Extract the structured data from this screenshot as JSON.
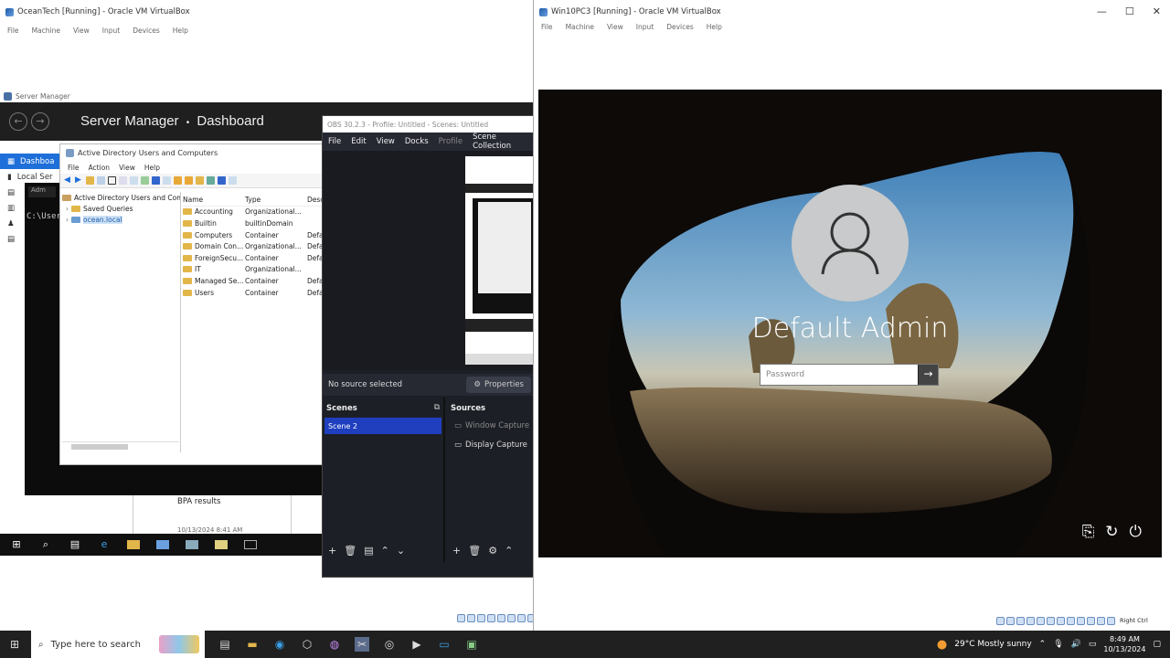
{
  "left_vm": {
    "title": "OceanTech [Running] - Oracle VM VirtualBox",
    "menu": [
      "File",
      "Machine",
      "View",
      "Input",
      "Devices",
      "Help"
    ]
  },
  "server_manager": {
    "window_title": "Server Manager",
    "breadcrumb_app": "Server Manager",
    "breadcrumb_sep": "•",
    "breadcrumb_page": "Dashboard",
    "side_items": [
      "Dashboa",
      "Local Ser"
    ],
    "bpa_label": "BPA results",
    "bpa_date": "10/13/2024 8:41 AM"
  },
  "cmd": {
    "prompt": "C:\\User"
  },
  "aduc": {
    "title": "Active Directory Users and Computers",
    "menu": [
      "File",
      "Action",
      "View",
      "Help"
    ],
    "tree": [
      "Active Directory Users and Com",
      "Saved Queries",
      "ocean.local"
    ],
    "columns": [
      "Name",
      "Type",
      "Desc"
    ],
    "rows": [
      {
        "name": "Accounting",
        "type": "Organizational...",
        "desc": ""
      },
      {
        "name": "Builtin",
        "type": "builtinDomain",
        "desc": ""
      },
      {
        "name": "Computers",
        "type": "Container",
        "desc": "Defa"
      },
      {
        "name": "Domain Con...",
        "type": "Organizational...",
        "desc": "Defa"
      },
      {
        "name": "ForeignSecu...",
        "type": "Container",
        "desc": "Defa"
      },
      {
        "name": "IT",
        "type": "Organizational...",
        "desc": ""
      },
      {
        "name": "Managed Se...",
        "type": "Container",
        "desc": "Defa"
      },
      {
        "name": "Users",
        "type": "Container",
        "desc": "Defa"
      }
    ]
  },
  "obs": {
    "title": "OBS 30.2.3 - Profile: Untitled - Scenes: Untitled",
    "menu": [
      "File",
      "Edit",
      "View",
      "Docks",
      "Profile",
      "Scene Collection"
    ],
    "no_source": "No source selected",
    "properties": "Properties",
    "scenes_title": "Scenes",
    "sources_title": "Sources",
    "scene": "Scene 2",
    "sources": [
      "Window Capture",
      "Display Capture"
    ]
  },
  "right_vm": {
    "title": "Win10PC3 [Running] - Oracle VM VirtualBox",
    "menu": [
      "File",
      "Machine",
      "View",
      "Input",
      "Devices",
      "Help"
    ],
    "user_name": "Default Admin",
    "password_placeholder": "Password",
    "host_key": "Right Ctrl"
  },
  "host_taskbar": {
    "search_placeholder": "Type here to search",
    "weather": "29°C  Mostly sunny",
    "time": "8:49 AM",
    "date": "10/13/2024"
  },
  "colors": {
    "obs_selected_scene": "#1f3fbf",
    "sm_selected": "#1e6fd9",
    "folder": "#e3b64a"
  }
}
